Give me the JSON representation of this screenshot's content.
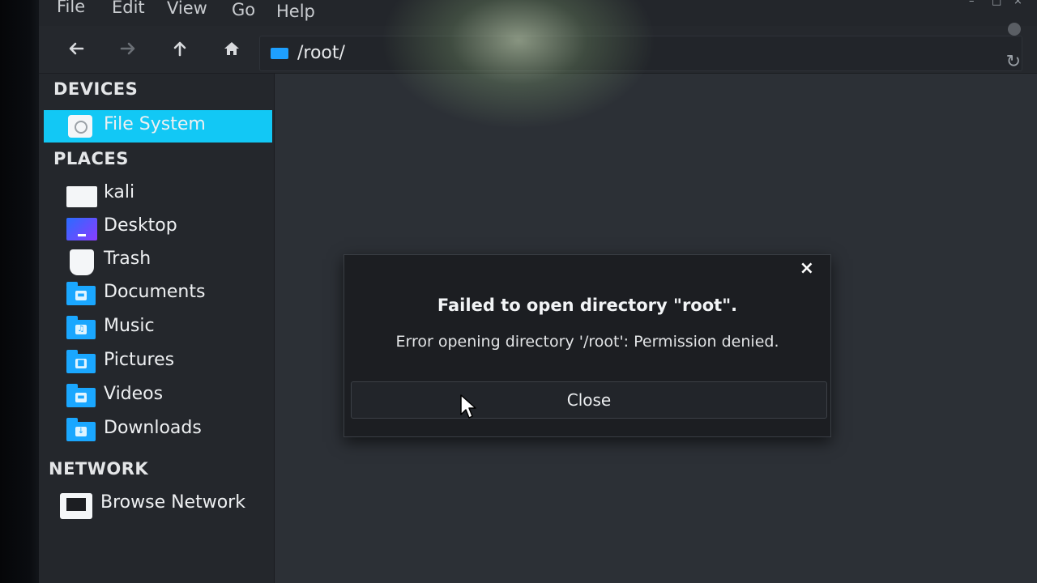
{
  "menubar": {
    "items": [
      "File",
      "Edit",
      "View",
      "Go",
      "Help"
    ]
  },
  "toolbar": {
    "back_icon": "arrow-left-icon",
    "forward_icon": "arrow-right-icon",
    "up_icon": "arrow-up-icon",
    "home_icon": "home-icon",
    "location": "/root/",
    "reload_icon": "reload-icon"
  },
  "sidebar": {
    "devices_title": "DEVICES",
    "devices": [
      {
        "label": "File System",
        "icon": "drive-icon",
        "selected": true
      }
    ],
    "places_title": "PLACES",
    "places": [
      {
        "label": "kali",
        "icon": "home-folder-icon"
      },
      {
        "label": "Desktop",
        "icon": "desktop-icon"
      },
      {
        "label": "Trash",
        "icon": "trash-icon"
      },
      {
        "label": "Documents",
        "icon": "documents-folder-icon"
      },
      {
        "label": "Music",
        "icon": "music-folder-icon"
      },
      {
        "label": "Pictures",
        "icon": "pictures-folder-icon"
      },
      {
        "label": "Videos",
        "icon": "videos-folder-icon"
      },
      {
        "label": "Downloads",
        "icon": "downloads-folder-icon"
      }
    ],
    "network_title": "NETWORK",
    "network": [
      {
        "label": "Browse Network",
        "icon": "network-icon"
      }
    ]
  },
  "dialog": {
    "title": "Failed to open directory \"root\".",
    "message": "Error opening directory '/root': Permission denied.",
    "button_label": "Close",
    "close_glyph": "×"
  },
  "colors": {
    "accent": "#12c8f5",
    "folder": "#1aa7ff"
  }
}
